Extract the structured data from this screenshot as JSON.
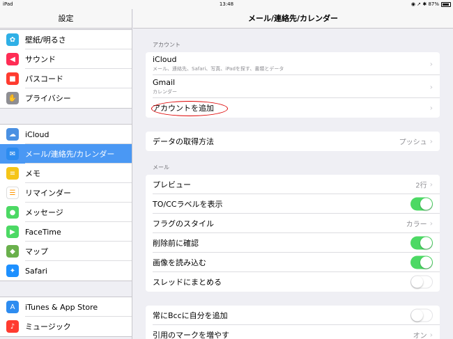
{
  "status": {
    "device": "iPad",
    "time": "13:48",
    "battery": "87%",
    "icons": "◉ ➚ ✱"
  },
  "sidebar": {
    "title": "設定",
    "groups": [
      [
        {
          "label": "壁紙/明るさ",
          "icon": "wallpaper-icon",
          "glyph": "✿",
          "color": "#2fb0e6"
        },
        {
          "label": "サウンド",
          "icon": "speaker-icon",
          "glyph": "◀",
          "color": "#ff2d55"
        },
        {
          "label": "パスコード",
          "icon": "lock-icon",
          "glyph": "■",
          "color": "#ff3b30"
        },
        {
          "label": "プライバシー",
          "icon": "hand-icon",
          "glyph": "✋",
          "color": "#8e8e93"
        }
      ],
      [
        {
          "label": "iCloud",
          "icon": "cloud-icon",
          "glyph": "☁",
          "color": "#4a90e2"
        },
        {
          "label": "メール/連絡先/カレンダー",
          "icon": "mail-icon",
          "glyph": "✉",
          "color": "#2d8cf0",
          "selected": true
        },
        {
          "label": "メモ",
          "icon": "notes-icon",
          "glyph": "≡",
          "color": "#f5c518"
        },
        {
          "label": "リマインダー",
          "icon": "reminders-icon",
          "glyph": "☰",
          "color": "#ffffff"
        },
        {
          "label": "メッセージ",
          "icon": "messages-icon",
          "glyph": "●",
          "color": "#4cd964"
        },
        {
          "label": "FaceTime",
          "icon": "facetime-icon",
          "glyph": "▶",
          "color": "#4cd964"
        },
        {
          "label": "マップ",
          "icon": "maps-icon",
          "glyph": "◆",
          "color": "#6ab04c"
        },
        {
          "label": "Safari",
          "icon": "safari-icon",
          "glyph": "✦",
          "color": "#1e90ff"
        }
      ],
      [
        {
          "label": "iTunes & App Store",
          "icon": "app-store-icon",
          "glyph": "A",
          "color": "#2d8cf0"
        },
        {
          "label": "ミュージック",
          "icon": "music-icon",
          "glyph": "♪",
          "color": "#ff3b30"
        }
      ]
    ]
  },
  "main": {
    "title": "メール/連絡先/カレンダー",
    "accounts_label": "アカウント",
    "accounts": [
      {
        "title": "iCloud",
        "subtitle": "メール、連絡先、Safari、写真、iPadを探す、書類とデータ"
      },
      {
        "title": "Gmail",
        "subtitle": "カレンダー"
      },
      {
        "title": "アカウントを追加"
      }
    ],
    "fetch": {
      "title": "データの取得方法",
      "value": "プッシュ"
    },
    "mail_label": "メール",
    "mail": [
      {
        "title": "プレビュー",
        "value": "2行",
        "type": "value"
      },
      {
        "title": "TO/CCラベルを表示",
        "type": "toggle",
        "on": true
      },
      {
        "title": "フラグのスタイル",
        "value": "カラー",
        "type": "value"
      },
      {
        "title": "削除前に確認",
        "type": "toggle",
        "on": true
      },
      {
        "title": "画像を読み込む",
        "type": "toggle",
        "on": true
      },
      {
        "title": "スレッドにまとめる",
        "type": "toggle",
        "on": false
      }
    ],
    "bcc": [
      {
        "title": "常にBccに自分を追加",
        "type": "toggle",
        "on": false
      },
      {
        "title": "引用のマークを増やす",
        "value": "オン",
        "type": "value"
      }
    ]
  }
}
